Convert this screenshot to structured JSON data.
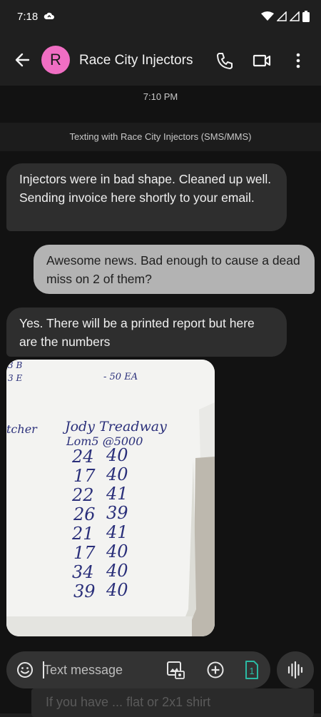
{
  "status_bar": {
    "time": "7:18",
    "icons": [
      "cloud-icon",
      "wifi-icon",
      "signal-icon",
      "signal-icon",
      "battery-icon"
    ]
  },
  "app_bar": {
    "avatar_letter": "R",
    "contact_name": "Race City Injectors",
    "avatar_color": "#f06ec3"
  },
  "conversation": {
    "timestamp": "7:10 PM",
    "info": "Texting with Race City Injectors (SMS/MMS)",
    "messages": [
      {
        "direction": "incoming",
        "text": "Injectors were in bad shape. Cleaned up well. Sending invoice here shortly to your email."
      },
      {
        "direction": "outgoing",
        "text": "Awesome news. Bad enough to cause a dead miss on 2 of them?"
      },
      {
        "direction": "incoming",
        "text": "Yes. There will be a printed report but here are the numbers"
      }
    ],
    "photo": {
      "corner_top": [
        "3 B",
        "3 E"
      ],
      "corner_right": "- 50 EA",
      "side_text": "tcher",
      "header_name": "Jody Treadway",
      "header_sub": "Lom5 @5000",
      "rows": [
        [
          "24",
          "40"
        ],
        [
          "17",
          "40"
        ],
        [
          "22",
          "41"
        ],
        [
          "26",
          "39"
        ],
        [
          "21",
          "41"
        ],
        [
          "17",
          "40"
        ],
        [
          "34",
          "40"
        ],
        [
          "39",
          "40"
        ]
      ]
    }
  },
  "compose": {
    "placeholder": "Text message",
    "sim_label": "1",
    "peek_text": "If you have ... flat or 2x1 shirt"
  },
  "colors": {
    "background": "#121212",
    "incoming_bubble": "#2e2e2e",
    "outgoing_bubble": "#b3b3b3",
    "accent": "#2bb9a3"
  }
}
